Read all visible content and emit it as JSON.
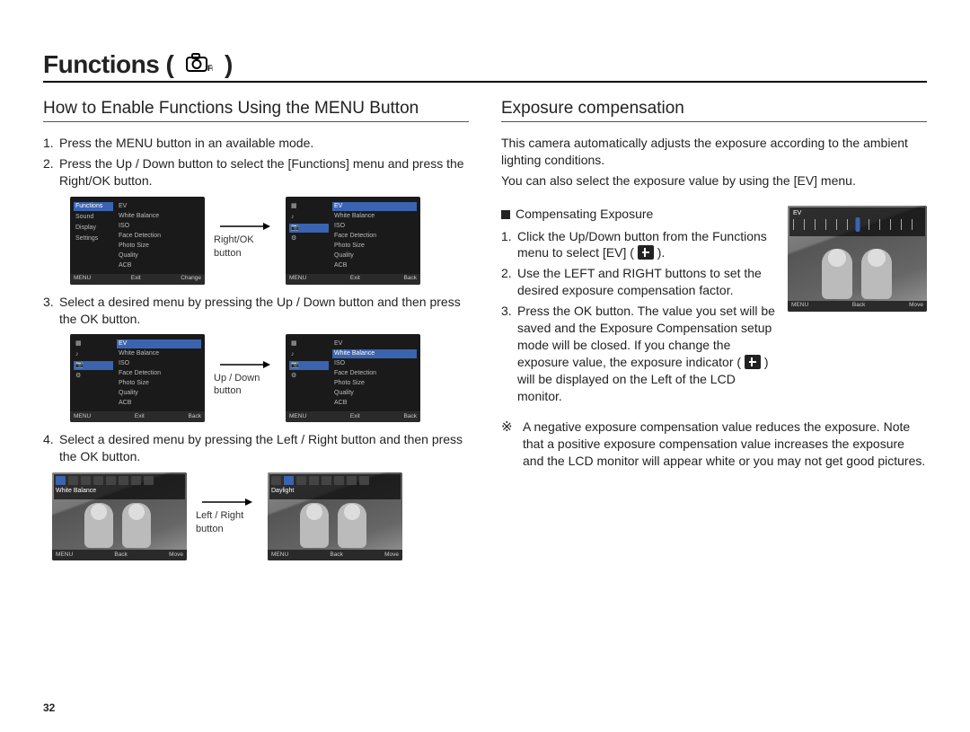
{
  "page_number": "32",
  "title_prefix": "Functions ( ",
  "title_suffix": " )",
  "left": {
    "heading": "How to Enable Functions Using the MENU Button",
    "steps": [
      "Press the MENU button in an available mode.",
      "Press the Up / Down button to select the [Functions] menu and press the Right/OK button.",
      "Select a desired menu by pressing the Up / Down button and then press the OK button.",
      "Select a desired menu by pressing the Left / Right button and then press the OK button."
    ],
    "arrow_labels": [
      "Right/OK button",
      "Up / Down button",
      "Left / Right button"
    ],
    "lcd1": {
      "sidebar": [
        "Functions",
        "Sound",
        "Display",
        "Settings"
      ],
      "sidebar_active": 0,
      "items": [
        "EV",
        "White Balance",
        "ISO",
        "Face Detection",
        "Photo Size",
        "Quality",
        "ACB"
      ],
      "active": -1,
      "foot_left": "Exit",
      "foot_right": "Change"
    },
    "lcd2": {
      "sidebar_icons": 5,
      "items": [
        "EV",
        "White Balance",
        "ISO",
        "Face Detection",
        "Photo Size",
        "Quality",
        "ACB"
      ],
      "active": 0,
      "foot_left": "Exit",
      "foot_right": "Back"
    },
    "lcd3": {
      "sidebar_icons": 5,
      "items": [
        "EV",
        "White Balance",
        "ISO",
        "Face Detection",
        "Photo Size",
        "Quality",
        "ACB"
      ],
      "active": 0,
      "foot_left": "Exit",
      "foot_right": "Back"
    },
    "lcd4": {
      "sidebar_icons": 5,
      "items": [
        "EV",
        "White Balance",
        "ISO",
        "Face Detection",
        "Photo Size",
        "Quality",
        "ACB"
      ],
      "active": 1,
      "foot_left": "Exit",
      "foot_right": "Back"
    },
    "lcd5": {
      "label": "White Balance",
      "icon_count": 8,
      "active_icon": 0,
      "foot_left": "Back",
      "foot_right": "Move"
    },
    "lcd6": {
      "label": "Daylight",
      "icon_count": 8,
      "active_icon": 1,
      "foot_left": "Back",
      "foot_right": "Move"
    }
  },
  "right": {
    "heading": "Exposure compensation",
    "intro1": "This camera automatically adjusts the exposure according to the ambient lighting conditions.",
    "intro2": "You can also select the exposure value by using the [EV] menu.",
    "sub": "Compensating Exposure",
    "steps": [
      "Click the Up/Down button from the Functions menu to select [EV] ( ",
      "Use the LEFT and RIGHT buttons to set the desired exposure compensation factor.",
      "Press the OK button. The value you set will be saved and the Exposure Compensation setup mode will be closed. If you change the exposure value, the exposure indicator ( "
    ],
    "step1_suffix": " ).",
    "step3_suffix": " ) will be displayed on the Left of the LCD monitor.",
    "note_symbol": "※",
    "note": "A negative exposure compensation value reduces the exposure. Note that a positive exposure compensation value increases the exposure and the LCD monitor will appear white or you may not get good pictures.",
    "ev_lcd": {
      "label": "EV",
      "foot_left": "Back",
      "foot_right": "Move"
    }
  }
}
